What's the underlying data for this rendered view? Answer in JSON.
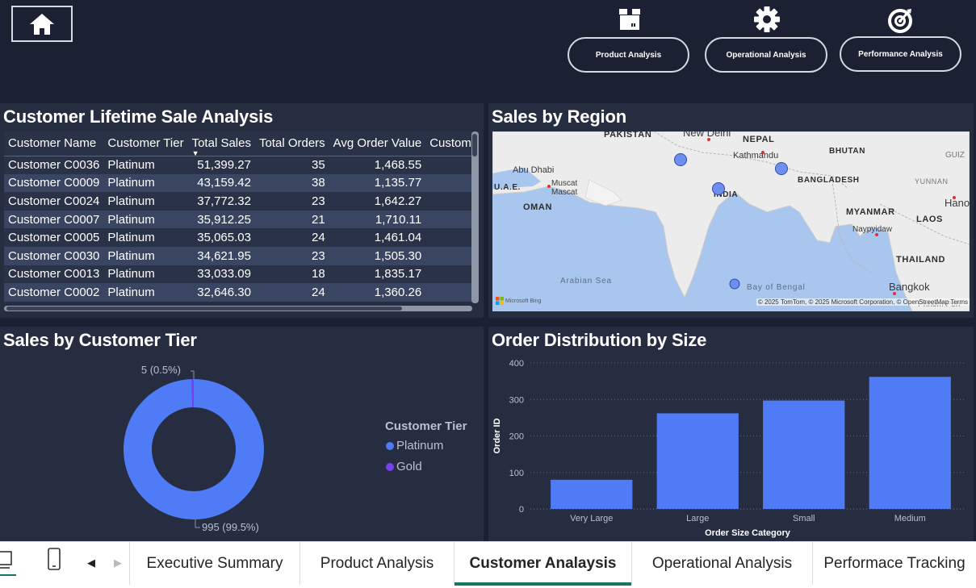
{
  "header": {
    "nav_buttons": [
      {
        "label": "Product Analysis",
        "icon": "box-icon"
      },
      {
        "label": "Operational Analysis",
        "icon": "gear-icon"
      },
      {
        "label": "Performance Analysis",
        "icon": "target-icon"
      }
    ]
  },
  "lifetime_table": {
    "title": "Customer Lifetime Sale Analysis",
    "columns": [
      "Customer Name",
      "Customer Tier",
      "Total Sales",
      "Total Orders",
      "Avg Order Value",
      "Customer"
    ],
    "rows": [
      [
        "Customer C0036",
        "Platinum",
        "51,399.27",
        "35",
        "1,468.55"
      ],
      [
        "Customer C0009",
        "Platinum",
        "43,159.42",
        "38",
        "1,135.77"
      ],
      [
        "Customer C0024",
        "Platinum",
        "37,772.32",
        "23",
        "1,642.27"
      ],
      [
        "Customer C0007",
        "Platinum",
        "35,912.25",
        "21",
        "1,710.11"
      ],
      [
        "Customer C0005",
        "Platinum",
        "35,065.03",
        "24",
        "1,461.04"
      ],
      [
        "Customer C0030",
        "Platinum",
        "34,621.95",
        "23",
        "1,505.30"
      ],
      [
        "Customer C0013",
        "Platinum",
        "33,033.09",
        "18",
        "1,835.17"
      ],
      [
        "Customer C0002",
        "Platinum",
        "32,646.30",
        "24",
        "1,360.26"
      ]
    ]
  },
  "region_map": {
    "title": "Sales by Region",
    "labels": {
      "pakistan": "PAKISTAN",
      "new_delhi": "New Delhi",
      "nepal": "NEPAL",
      "bhutan": "BHUTAN",
      "gui": "GUIZ",
      "kathmandu": "Kathmandu",
      "abu_dhabi": "Abu Dhabi",
      "muscat1": "Muscat",
      "muscat2": "Mascat",
      "uae": "U.A.E.",
      "bangladesh": "BANGLADESH",
      "yunnan": "YUNNAN",
      "india": "INDIA",
      "hanoi": "Hano",
      "oman": "OMAN",
      "myanmar": "MYANMAR",
      "laos": "LAOS",
      "naypyidaw": "Naypyidaw",
      "thailand": "THAILAND",
      "arabian_sea": "Arabian Sea",
      "bay_of_bengal": "Bay of Bengal",
      "bangkok": "Bangkok",
      "phnom_penh": "Phnom Pen"
    },
    "attribution": "© 2025 TomTom, © 2025 Microsoft Corporation, © OpenStreetMap Terms",
    "bing": "Microsoft Bing"
  },
  "tier_chart": {
    "title": "Sales by Customer Tier",
    "legend_title": "Customer Tier",
    "label_small": "5 (0.5%)",
    "label_large": "995 (99.5%)"
  },
  "chart_data": [
    {
      "type": "pie",
      "title": "Sales by Customer Tier",
      "legend_title": "Customer Tier",
      "labels": [
        "Platinum",
        "Gold"
      ],
      "values": [
        995,
        5
      ],
      "colors": [
        "#4f7cf6",
        "#7b3ff2"
      ],
      "legend_position": "right"
    },
    {
      "type": "bar",
      "title": "Order Distribution by Size",
      "categories": [
        "Very Large",
        "Large",
        "Small",
        "Medium"
      ],
      "values": [
        80,
        262,
        297,
        362
      ],
      "xlabel": "Order Size Category",
      "ylabel": "Order ID",
      "ylim": [
        0,
        400
      ],
      "yticks": [
        0,
        100,
        200,
        300,
        400
      ],
      "grid": true,
      "color": "#4f7cf6"
    }
  ],
  "tabbar": {
    "tabs": [
      {
        "label": "Executive Summary",
        "active": false
      },
      {
        "label": "Product Analysis",
        "active": false
      },
      {
        "label": "Customer Analaysis",
        "active": true
      },
      {
        "label": "Operational Analysis",
        "active": false
      },
      {
        "label": "Performace Tracking",
        "active": false
      }
    ]
  }
}
